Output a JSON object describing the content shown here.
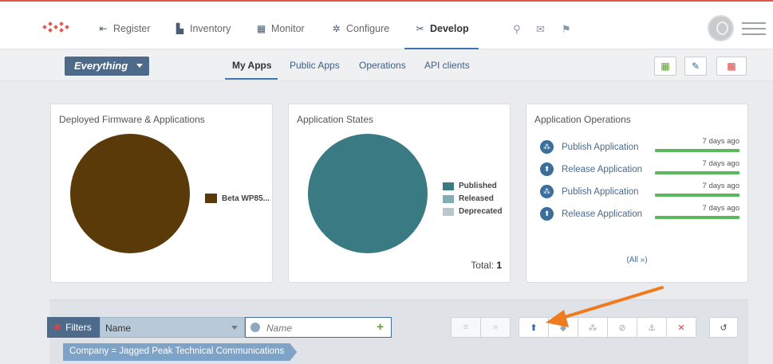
{
  "nav": {
    "items": [
      {
        "label": "Register",
        "icon": "register-icon",
        "glyph": "⇤"
      },
      {
        "label": "Inventory",
        "icon": "inventory-icon",
        "glyph": "▙"
      },
      {
        "label": "Monitor",
        "icon": "monitor-icon",
        "glyph": "▦"
      },
      {
        "label": "Configure",
        "icon": "gear-icon",
        "glyph": "✲"
      },
      {
        "label": "Develop",
        "icon": "tools-icon",
        "glyph": "✂"
      }
    ],
    "active": "Develop"
  },
  "scope": {
    "label": "Everything"
  },
  "subtabs": [
    {
      "label": "My Apps",
      "active": true
    },
    {
      "label": "Public Apps"
    },
    {
      "label": "Operations"
    },
    {
      "label": "API clients"
    }
  ],
  "cards": {
    "firmware": {
      "title": "Deployed Firmware & Applications",
      "legend": [
        {
          "label": "Beta WP85...",
          "color": "#5a3a08"
        }
      ]
    },
    "states": {
      "title": "Application States",
      "legend": [
        {
          "label": "Published",
          "color": "#3a7a82"
        },
        {
          "label": "Released",
          "color": "#7faeb4"
        },
        {
          "label": "Deprecated",
          "color": "#b7c7cc"
        }
      ],
      "total_label": "Total:",
      "total_value": "1"
    },
    "operations": {
      "title": "Application Operations",
      "rows": [
        {
          "label": "Publish Application",
          "time": "7 days ago",
          "icon": "publish-icon",
          "glyph": "⁂"
        },
        {
          "label": "Release Application",
          "time": "7 days ago",
          "icon": "release-icon",
          "glyph": "⬆"
        },
        {
          "label": "Publish Application",
          "time": "7 days ago",
          "icon": "publish-icon",
          "glyph": "⁂"
        },
        {
          "label": "Release Application",
          "time": "7 days ago",
          "icon": "release-icon",
          "glyph": "⬆"
        }
      ],
      "all_link": "(All »)"
    }
  },
  "filters": {
    "label": "Filters",
    "field": "Name",
    "placeholder": "Name",
    "chip": "Company = Jagged Peak Technical Communications"
  },
  "colors": {
    "accent": "#3a76b3",
    "topline": "#e05a4f",
    "arrow": "#f07a1e"
  }
}
